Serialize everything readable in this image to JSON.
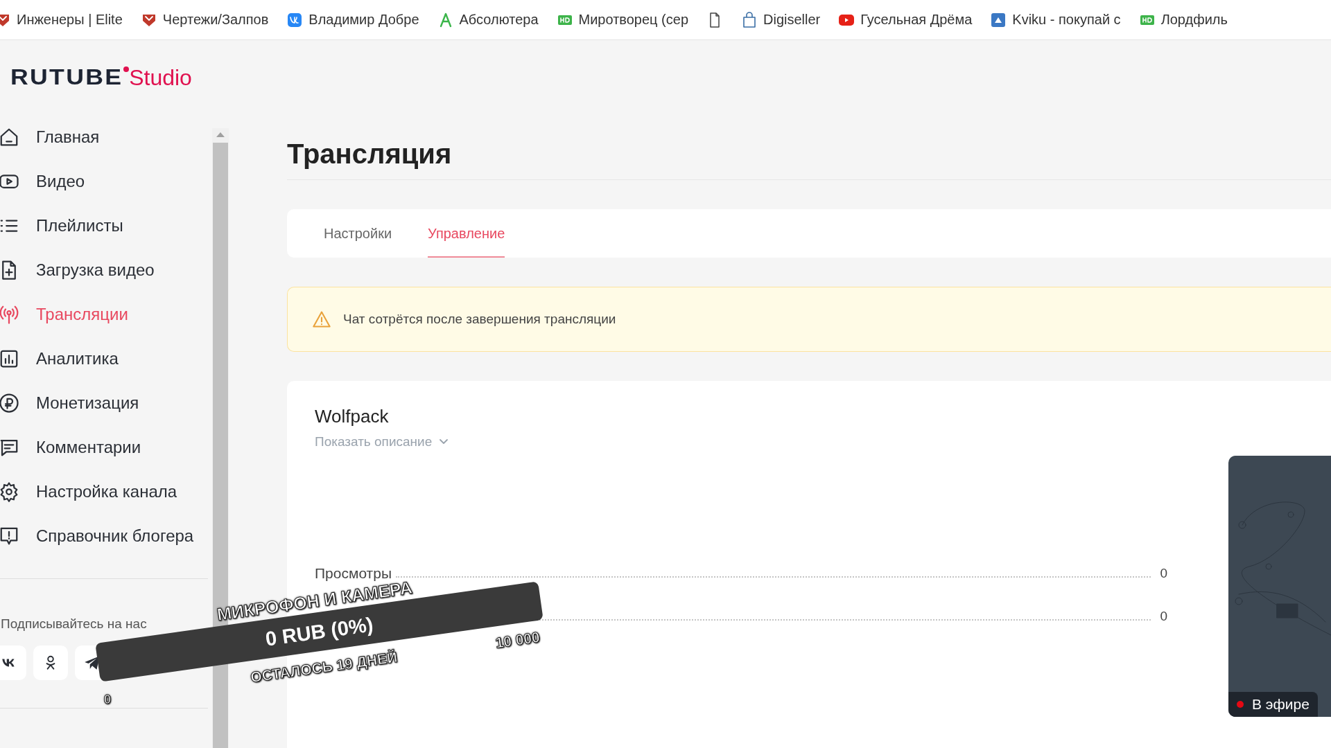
{
  "bookmarks": [
    {
      "label": "Инженеры | Elite",
      "kind": "shield"
    },
    {
      "label": "Чертежи/Залпов",
      "kind": "shield"
    },
    {
      "label": "Владимир Добре",
      "kind": "vk"
    },
    {
      "label": "Абсолютера",
      "kind": "letter"
    },
    {
      "label": "Миротворец (сер",
      "kind": "hd"
    },
    {
      "kind": "doc"
    },
    {
      "label": "Digiseller",
      "kind": "bag"
    },
    {
      "label": "Гусельная Дрёма",
      "kind": "play"
    },
    {
      "label": "Kviku - покупай с",
      "kind": "puzzle"
    },
    {
      "label": "Лордфиль",
      "kind": "hd"
    }
  ],
  "logo": {
    "brand": "RUTUBE",
    "product": "Studio"
  },
  "sidebar": {
    "items": [
      {
        "label": "Главная",
        "kind": "home",
        "selected": false
      },
      {
        "label": "Видео",
        "kind": "video",
        "selected": false
      },
      {
        "label": "Плейлисты",
        "kind": "list",
        "selected": false
      },
      {
        "label": "Загрузка видео",
        "kind": "upload",
        "selected": false
      },
      {
        "label": "Трансляции",
        "kind": "broadcast",
        "selected": true
      },
      {
        "label": "Аналитика",
        "kind": "chart",
        "selected": false
      },
      {
        "label": "Монетизация",
        "kind": "ruble",
        "selected": false
      },
      {
        "label": "Комментарии",
        "kind": "comment",
        "selected": false
      },
      {
        "label": "Настройка канала",
        "kind": "gear",
        "selected": false
      },
      {
        "label": "Справочник блогера",
        "kind": "info",
        "selected": false
      }
    ],
    "follow_label": "Подписывайтесь на нас",
    "social": [
      {
        "kind": "vk"
      },
      {
        "kind": "ok"
      },
      {
        "kind": "telegram"
      }
    ]
  },
  "page": {
    "title": "Трансляция",
    "tabs": [
      {
        "label": "Настройки",
        "selected": false
      },
      {
        "label": "Управление",
        "selected": true
      }
    ],
    "alert": "Чат сотрётся после завершения трансляции",
    "stream": {
      "title": "Wolfpack",
      "description_toggle": "Показать описание",
      "stats": [
        {
          "label": "Просмотры",
          "value": "0"
        },
        {
          "value": "0"
        }
      ],
      "preview": {
        "badge": "В эфире",
        "live": true
      }
    }
  },
  "overlay": {
    "title": "МИКРОФОН И КАМЕРА",
    "amount": "0 RUB (0%)",
    "remaining": "ОСТАЛОСЬ 19 ДНЕЙ",
    "goal": "10 000",
    "start": "0"
  }
}
